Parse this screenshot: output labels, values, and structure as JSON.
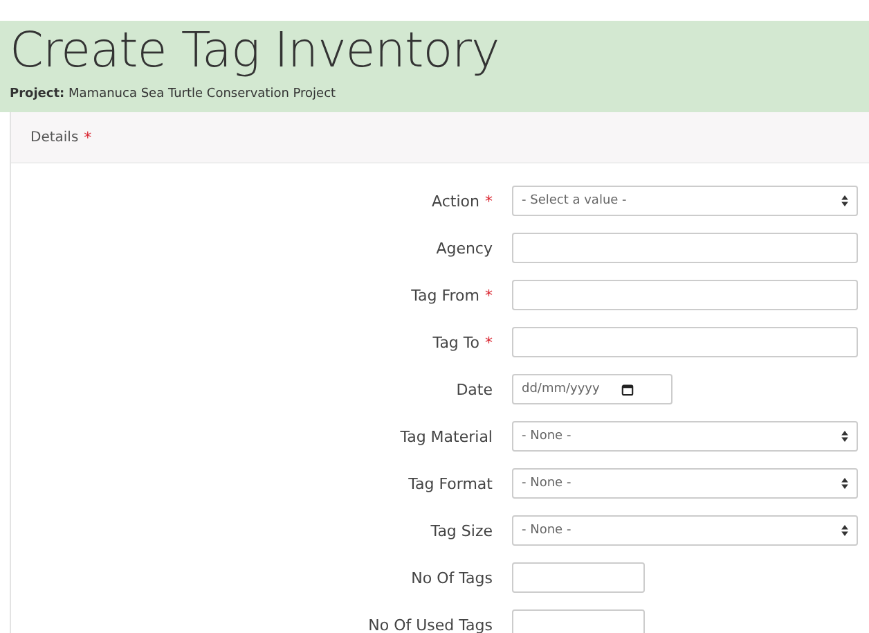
{
  "page_title": "Create Tag Inventory",
  "project": {
    "label": "Project:",
    "value": "Mamanuca Sea Turtle Conservation Project"
  },
  "section": {
    "label": "Details",
    "marker": "*"
  },
  "fields": [
    {
      "label": "Action",
      "marker": "*",
      "kind": "select",
      "value": "- Select a value -"
    },
    {
      "label": "Agency",
      "kind": "text"
    },
    {
      "label": "Tag From",
      "marker": "*",
      "kind": "text"
    },
    {
      "label": "Tag To",
      "marker": "*",
      "kind": "text"
    },
    {
      "label": "Date",
      "kind": "date",
      "placeholder": "dd/mm/yyyy"
    },
    {
      "label": "Tag Material",
      "kind": "select",
      "value": "- None -"
    },
    {
      "label": "Tag Format",
      "kind": "select",
      "value": "- None -"
    },
    {
      "label": "Tag Size",
      "kind": "select",
      "value": "- None -"
    },
    {
      "label": "No Of Tags",
      "kind": "short"
    },
    {
      "label": "No Of Used Tags",
      "kind": "short"
    }
  ]
}
